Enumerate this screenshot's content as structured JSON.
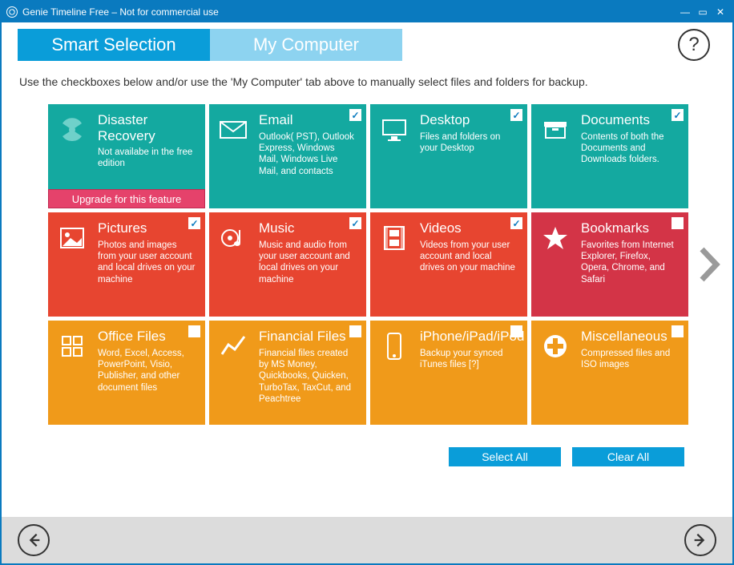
{
  "window": {
    "title": "Genie Timeline Free – Not for commercial use"
  },
  "tabs": {
    "smart": "Smart Selection",
    "mycomputer": "My Computer"
  },
  "help": "?",
  "instruction": "Use the checkboxes below and/or use the 'My Computer' tab above to manually select files and folders for backup.",
  "cards": {
    "disaster": {
      "title": "Disaster Recovery",
      "desc": "Not availabe in the free edition",
      "upgrade": "Upgrade for this feature"
    },
    "email": {
      "title": "Email",
      "desc": "Outlook( PST), Outlook Express, Windows Mail, Windows Live Mail, and contacts",
      "checked": true
    },
    "desktop": {
      "title": "Desktop",
      "desc": "Files and folders on your Desktop",
      "checked": true
    },
    "documents": {
      "title": "Documents",
      "desc": "Contents of both the Documents and Downloads folders.",
      "checked": true
    },
    "pictures": {
      "title": "Pictures",
      "desc": "Photos and images from your user account and local drives on your machine",
      "checked": true
    },
    "music": {
      "title": "Music",
      "desc": "Music and audio from your user account and local drives on your machine",
      "checked": true
    },
    "videos": {
      "title": "Videos",
      "desc": "Videos from your user account and local drives on your machine",
      "checked": true
    },
    "bookmarks": {
      "title": "Bookmarks",
      "desc": "Favorites from Internet Explorer, Firefox, Opera, Chrome, and Safari",
      "checked": false
    },
    "office": {
      "title": "Office Files",
      "desc": "Word, Excel, Access, PowerPoint, Visio, Publisher, and other document files",
      "checked": false
    },
    "financial": {
      "title": "Financial Files",
      "desc": "Financial files created by MS Money, Quickbooks, Quicken, TurboTax, TaxCut, and Peachtree",
      "checked": false
    },
    "iphone": {
      "title": "iPhone/iPad/iPod",
      "desc": "Backup your synced iTunes files [?]",
      "checked": false
    },
    "misc": {
      "title": "Miscellaneous",
      "desc": "Compressed files and ISO images",
      "checked": false
    }
  },
  "actions": {
    "selectAll": "Select All",
    "clearAll": "Clear All"
  }
}
